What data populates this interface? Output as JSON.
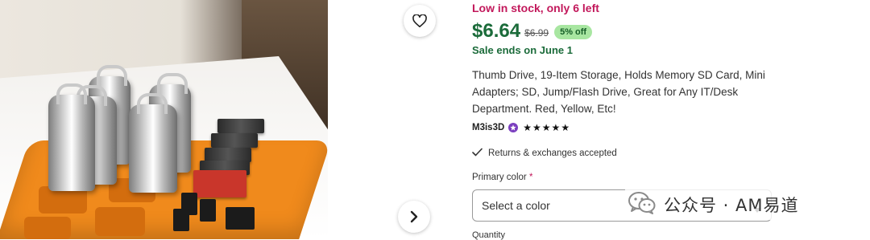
{
  "photo": {
    "alt": "Orange 3D-printed storage tray holding USB thumb drives and SD cards"
  },
  "nav": {
    "favorite_icon": "heart-icon",
    "next_icon": "chevron-right-icon"
  },
  "product": {
    "stock_notice": "Low in stock, only 6 left",
    "price": "$6.64",
    "original_price": "$6.99",
    "discount": "5% off",
    "sale_notice": "Sale ends on June 1",
    "title": "Thumb Drive, 19-Item Storage, Holds Memory SD Card, Mini Adapters; SD, Jump/Flash Drive, Great for Any IT/Desk Department. Red, Yellow, Etc!",
    "seller": "M3is3D",
    "seller_badge_icon": "star-seller-badge-icon",
    "rating_stars": 5,
    "rating_display": "★★★★★",
    "returns": "Returns & exchanges accepted",
    "primary_color_label": "Primary color",
    "required_mark": "*",
    "color_select_value": "Select a color",
    "quantity_label": "Quantity"
  },
  "watermark": {
    "icon": "wechat-icon",
    "text": "公众号 · AM易道"
  },
  "colors": {
    "stock": "#c2185b",
    "price": "#1b6b3a",
    "discount_bg": "#a8e6a1",
    "star_seller": "#7b3fbf",
    "tray": "#f08a1c"
  }
}
